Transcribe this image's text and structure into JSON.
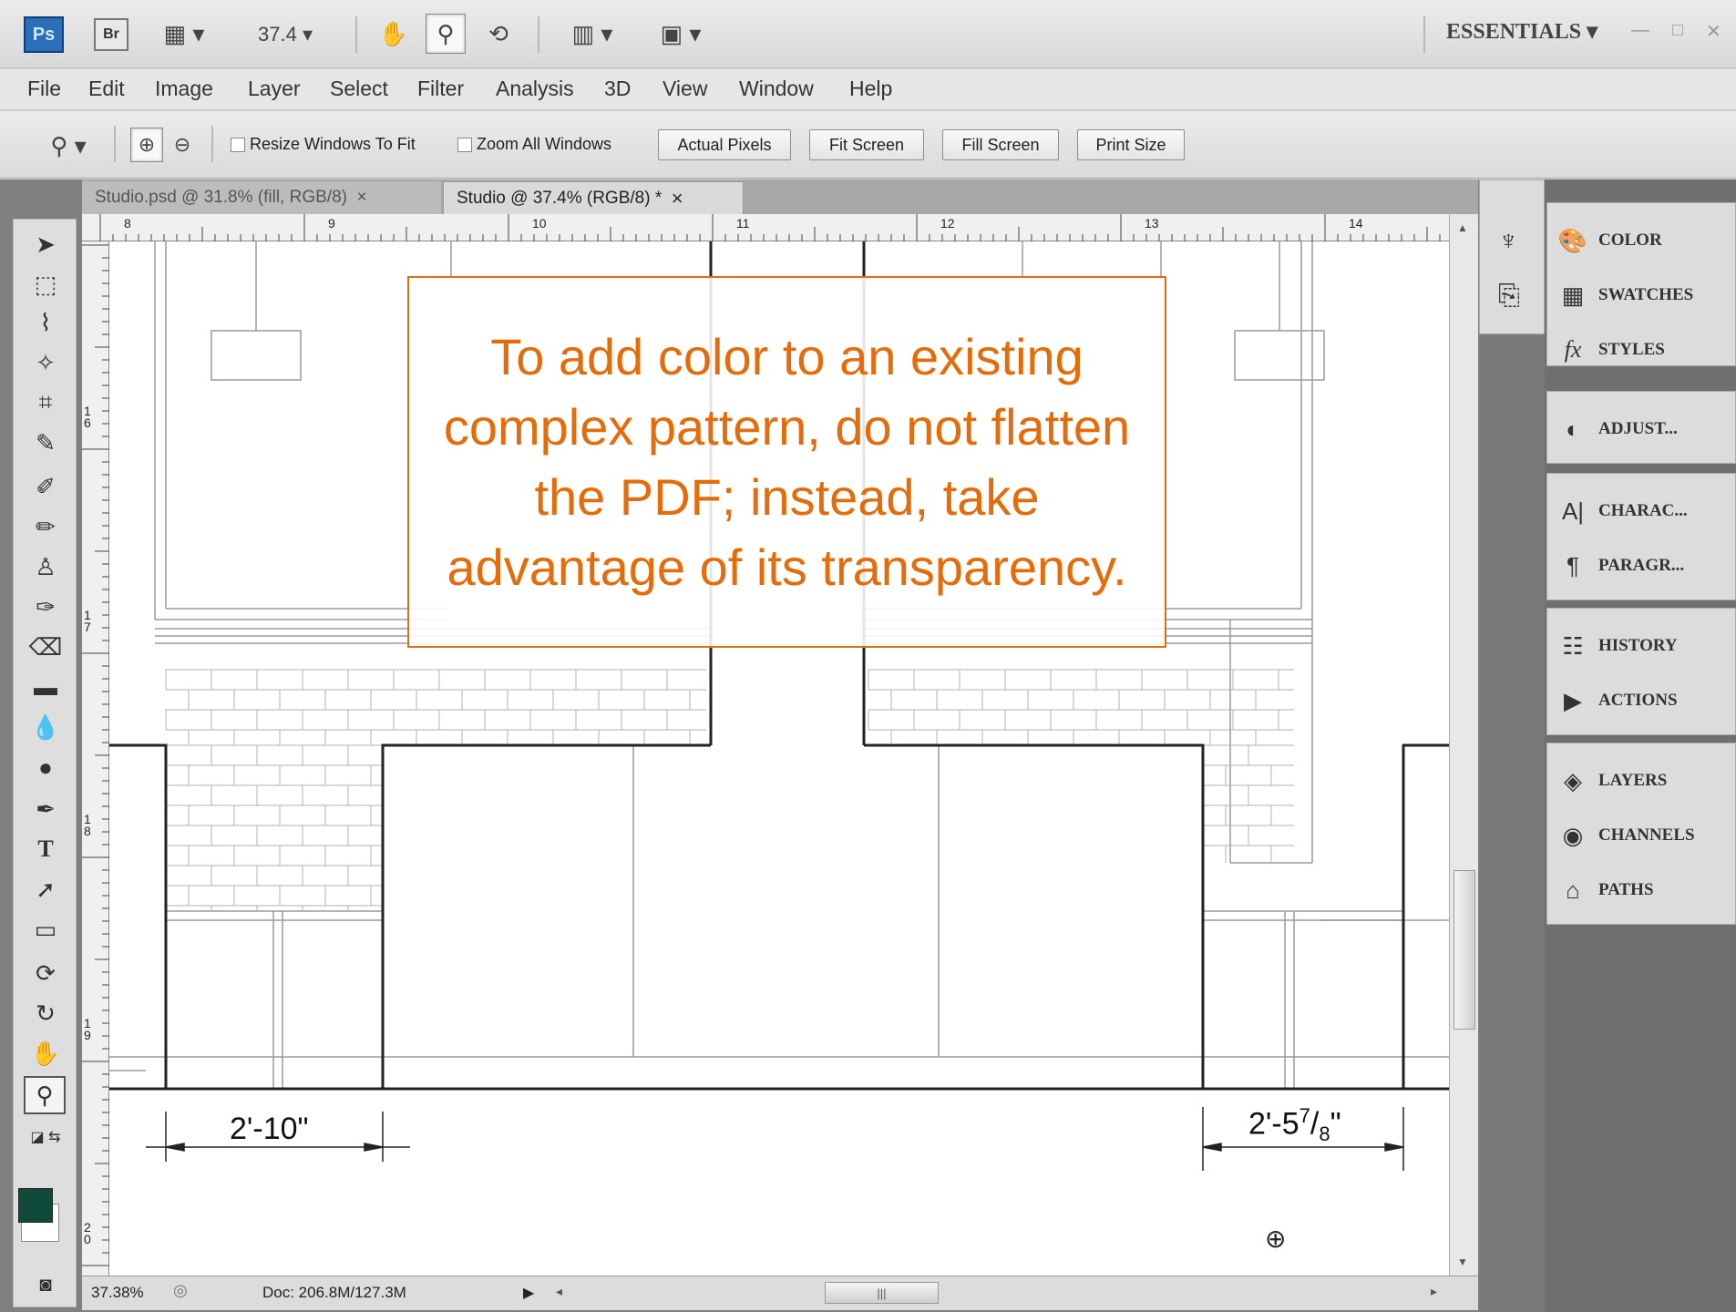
{
  "appbar": {
    "ps_logo": "Ps",
    "br_logo": "Br",
    "zoom_value": "37.4",
    "workspace": "ESSENTIALS",
    "icons": [
      "launch-bridge-icon",
      "view-extras-icon",
      "hand-tool-icon",
      "zoom-tool-icon",
      "rotate-view-icon",
      "arrange-documents-icon",
      "screen-mode-icon"
    ]
  },
  "menu": [
    "File",
    "Edit",
    "Image",
    "Layer",
    "Select",
    "Filter",
    "Analysis",
    "3D",
    "View",
    "Window",
    "Help"
  ],
  "options": {
    "resize_windows": "Resize Windows To Fit",
    "zoom_all": "Zoom All Windows",
    "actual_pixels": "Actual Pixels",
    "fit_screen": "Fit Screen",
    "fill_screen": "Fill Screen",
    "print_size": "Print Size"
  },
  "tabs": [
    {
      "label": "Studio.psd @ 31.8% (fill, RGB/8)",
      "close": "×",
      "active": false
    },
    {
      "label": "Studio @ 37.4% (RGB/8) *",
      "close": "×",
      "active": true
    }
  ],
  "ruler": {
    "top": [
      "8",
      "9",
      "10",
      "11",
      "12",
      "13",
      "14"
    ],
    "left": [
      "16",
      "17",
      "18",
      "19",
      "20"
    ]
  },
  "drawing": {
    "dim_left": "2'-10\"",
    "dim_right_main": "2'-5",
    "dim_right_num": "7",
    "dim_right_den": "8",
    "dim_right_end": "\""
  },
  "callout": "To add color to an existing complex pattern, do not flatten the PDF; instead, take advantage of its transparency.",
  "status": {
    "zoom": "37.38%",
    "doc": "Doc: 206.8M/127.3M"
  },
  "panels": [
    {
      "group": 1,
      "items": [
        {
          "label": "COLOR",
          "icon": "color-icon"
        },
        {
          "label": "SWATCHES",
          "icon": "swatches-icon"
        },
        {
          "label": "STYLES",
          "icon": "styles-icon"
        }
      ]
    },
    {
      "group": 2,
      "items": [
        {
          "label": "ADJUST...",
          "icon": "adjustments-icon"
        }
      ]
    },
    {
      "group": 3,
      "items": [
        {
          "label": "CHARAC...",
          "icon": "character-icon"
        },
        {
          "label": "PARAGR...",
          "icon": "paragraph-icon"
        }
      ]
    },
    {
      "group": 4,
      "items": [
        {
          "label": "HISTORY",
          "icon": "history-icon"
        },
        {
          "label": "ACTIONS",
          "icon": "actions-icon"
        }
      ]
    },
    {
      "group": 5,
      "items": [
        {
          "label": "LAYERS",
          "icon": "layers-icon"
        },
        {
          "label": "CHANNELS",
          "icon": "channels-icon"
        },
        {
          "label": "PATHS",
          "icon": "paths-icon"
        }
      ]
    }
  ],
  "colors": {
    "foreground": "#0f4a3a",
    "background": "#ffffff",
    "accent": "#e46c0a"
  }
}
